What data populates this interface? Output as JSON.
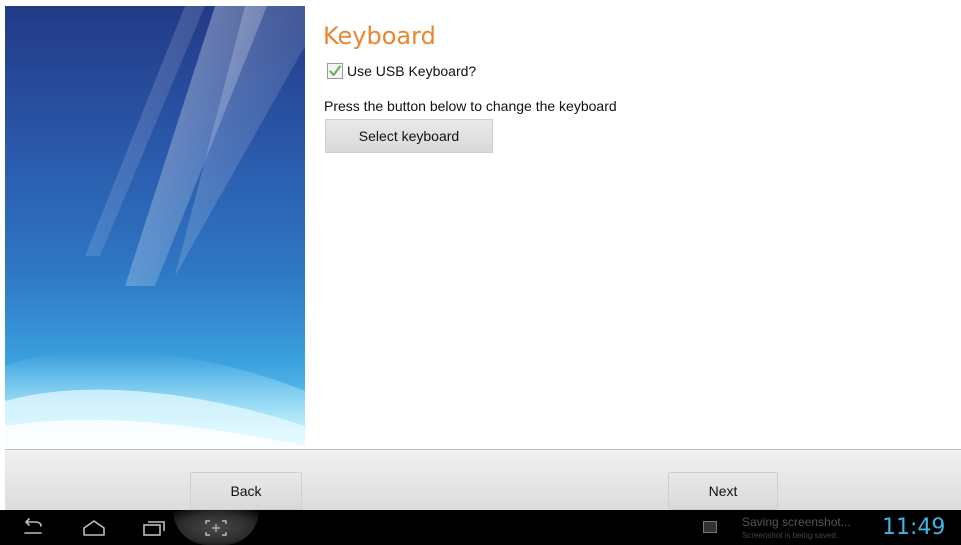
{
  "page": {
    "title": "Keyboard",
    "usb_keyboard_checkbox": {
      "label": "Use USB Keyboard?",
      "checked": true
    },
    "instruction": "Press the button below to change the keyboard",
    "select_keyboard_label": "Select keyboard"
  },
  "footer": {
    "back_label": "Back",
    "next_label": "Next"
  },
  "system_bar": {
    "notification_title": "Saving screenshot...",
    "notification_subtitle": "Screenshot is being saved.",
    "clock": "11:49",
    "icons": [
      "back-icon",
      "home-icon",
      "recent-apps-icon",
      "screenshot-icon",
      "image-thumbnail-icon"
    ]
  },
  "colors": {
    "title": "#e8872f",
    "clock": "#3fb4e6",
    "check": "#6ab04c"
  }
}
